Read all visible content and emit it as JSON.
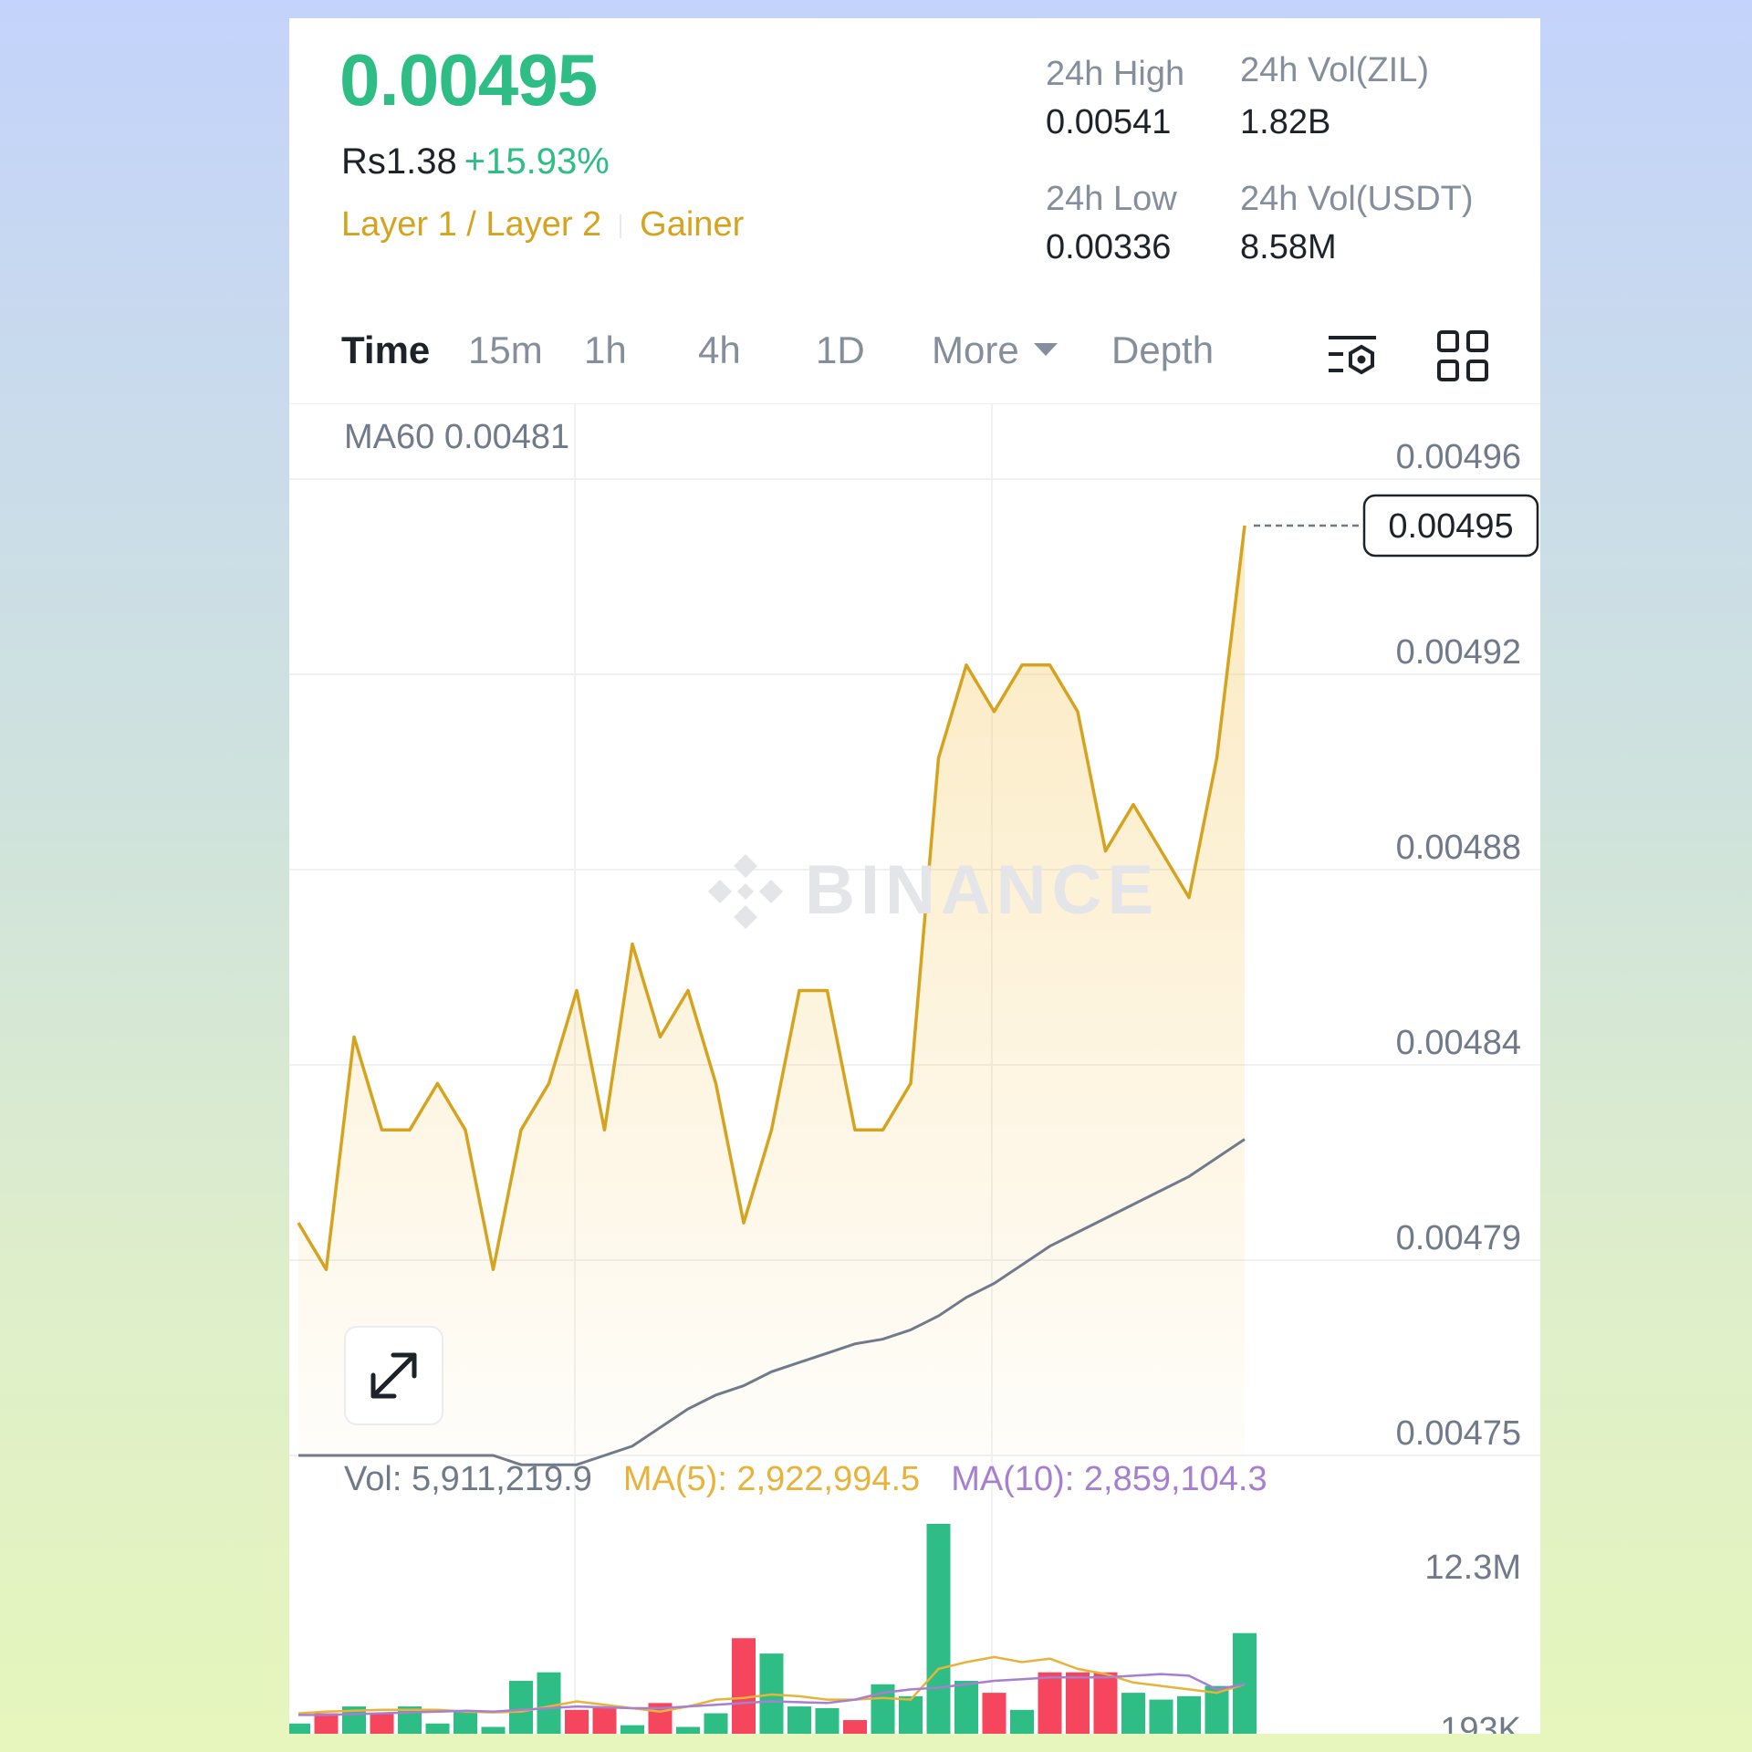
{
  "header": {
    "last_price": "0.00495",
    "local_price": "Rs1.38",
    "change_pct": "+15.93%",
    "tag_category": "Layer 1 / Layer 2",
    "tag_status": "Gainer"
  },
  "stats": {
    "high_label": "24h High",
    "high_value": "0.00541",
    "low_label": "24h Low",
    "low_value": "0.00336",
    "vol_zil_label": "24h Vol(ZIL)",
    "vol_zil_value": "1.82B",
    "vol_usdt_label": "24h Vol(USDT)",
    "vol_usdt_value": "8.58M"
  },
  "tabs": {
    "time": "Time",
    "m15": "15m",
    "h1": "1h",
    "h4": "4h",
    "d1": "1D",
    "more": "More",
    "depth": "Depth"
  },
  "icons": {
    "indicator_settings": "indicator-settings-icon",
    "layout_grid": "grid-layout-icon",
    "expand": "expand-icon",
    "watermark": "binance-logo-icon"
  },
  "overlay": {
    "ma60_label": "MA60 0.00481",
    "watermark_text": "BINANCE",
    "current_price_tag": "0.00495"
  },
  "volume_legend": {
    "vol": "Vol: 5,911,219.9",
    "ma5": "MA(5): 2,922,994.5",
    "ma10": "MA(10): 2,859,104.3"
  },
  "colors": {
    "up": "#2ebd85",
    "down": "#f6465d",
    "price_line": "#d6a31e",
    "ma60": "#707a8a",
    "ma5": "#e8b33a",
    "ma10": "#a77fd1",
    "brand_yellow": "#d6a31e"
  },
  "chart_data": [
    {
      "type": "line",
      "yticks": [
        "0.00496",
        "0.00492",
        "0.00488",
        "0.00484",
        "0.00479",
        "0.00475"
      ],
      "ylim": [
        0.00475,
        0.00496
      ],
      "series": [
        {
          "name": "price",
          "values": [
            0.0048,
            0.00479,
            0.00484,
            0.00482,
            0.00482,
            0.00483,
            0.00482,
            0.00479,
            0.00482,
            0.00483,
            0.00485,
            0.00482,
            0.00486,
            0.00484,
            0.00485,
            0.00483,
            0.0048,
            0.00482,
            0.00485,
            0.00485,
            0.00482,
            0.00482,
            0.00483,
            0.0049,
            0.00492,
            0.00491,
            0.00492,
            0.00492,
            0.00491,
            0.00488,
            0.00489,
            0.00488,
            0.00487,
            0.0049,
            0.00495
          ]
        },
        {
          "name": "MA60",
          "values": [
            0.00475,
            0.00475,
            0.00475,
            0.00475,
            0.00475,
            0.00475,
            0.00475,
            0.00475,
            0.004748,
            0.004748,
            0.004748,
            0.00475,
            0.004752,
            0.004756,
            0.00476,
            0.004763,
            0.004765,
            0.004768,
            0.00477,
            0.004772,
            0.004774,
            0.004775,
            0.004777,
            0.00478,
            0.004784,
            0.004787,
            0.004791,
            0.004795,
            0.004798,
            0.004801,
            0.004804,
            0.004807,
            0.00481,
            0.004814,
            0.004818
          ]
        }
      ]
    },
    {
      "type": "bar",
      "yticks": [
        "12.3M",
        "193K"
      ],
      "ylim": [
        193000,
        12300000
      ],
      "values": [
        0.6,
        1.2,
        1.6,
        1.2,
        1.6,
        0.6,
        1.3,
        0.4,
        3.1,
        3.6,
        1.4,
        1.5,
        0.5,
        1.8,
        0.4,
        1.2,
        5.6,
        4.7,
        1.6,
        1.5,
        0.8,
        2.9,
        2.2,
        12.3,
        3.1,
        2.4,
        1.4,
        3.6,
        3.6,
        3.6,
        2.4,
        2.0,
        2.2,
        2.8,
        5.9
      ],
      "up": [
        true,
        false,
        true,
        false,
        true,
        true,
        true,
        true,
        true,
        true,
        false,
        false,
        true,
        false,
        true,
        true,
        false,
        true,
        true,
        true,
        false,
        true,
        true,
        true,
        true,
        false,
        true,
        false,
        false,
        false,
        true,
        true,
        true,
        true,
        true
      ],
      "series": [
        {
          "name": "MA(5)",
          "values": [
            1.2,
            1.3,
            1.35,
            1.4,
            1.4,
            1.4,
            1.3,
            1.25,
            1.3,
            1.6,
            1.9,
            1.7,
            1.5,
            1.3,
            1.6,
            2.0,
            2.1,
            2.3,
            2.2,
            2.0,
            2.0,
            2.1,
            2.0,
            3.8,
            4.2,
            4.5,
            4.2,
            4.4,
            3.8,
            3.5,
            3.0,
            2.8,
            2.6,
            2.4,
            2.9
          ]
        },
        {
          "name": "MA(10)",
          "values": [
            1.1,
            1.1,
            1.15,
            1.2,
            1.25,
            1.3,
            1.35,
            1.3,
            1.4,
            1.5,
            1.6,
            1.55,
            1.5,
            1.5,
            1.6,
            1.7,
            1.8,
            1.9,
            1.85,
            1.8,
            2.0,
            2.4,
            2.6,
            2.7,
            2.9,
            3.1,
            3.2,
            3.3,
            3.3,
            3.3,
            3.4,
            3.5,
            3.4,
            2.6,
            2.9
          ]
        }
      ]
    }
  ]
}
